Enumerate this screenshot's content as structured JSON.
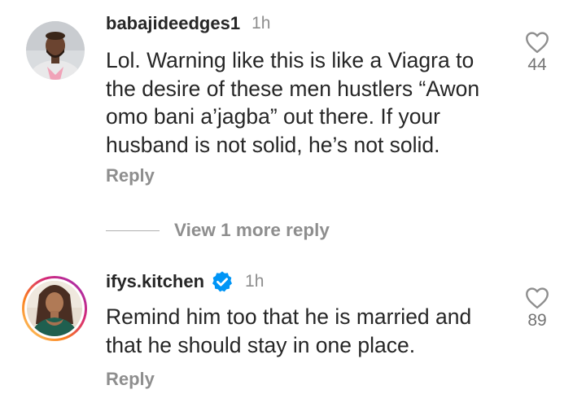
{
  "comments": [
    {
      "username": "babajideedges1",
      "time": "1h",
      "text": "Lol. Warning like this is like a Viagra to\nthe desire of these men hustlers “Awon\nomo bani a’jagba” out there. If your\nhusband is not solid, he’s not solid.",
      "reply_label": "Reply",
      "likes": "44",
      "verified": false,
      "avatar_icon": "man-avatar"
    },
    {
      "username": "ifys.kitchen",
      "time": "1h",
      "text": "Remind him too that he is married and\nthat he should stay in one place.",
      "reply_label": "Reply",
      "likes": "89",
      "verified": true,
      "avatar_icon": "woman-avatar-story-ring"
    }
  ],
  "view_more_replies": "View 1 more reply",
  "colors": {
    "text": "#262626",
    "muted": "#8e8e8e",
    "verified_blue": "#0095f6",
    "story_ring": [
      "#feda75",
      "#fa7e1e",
      "#d62976",
      "#962fbf"
    ]
  },
  "icons": {
    "like": "heart-outline-icon",
    "verified": "verified-badge-icon"
  }
}
